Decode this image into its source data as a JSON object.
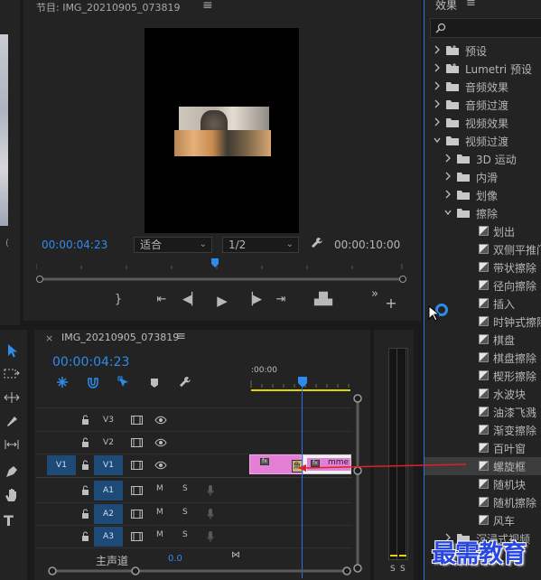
{
  "program": {
    "title": "节目: IMG_20210905_073819",
    "menu": "≡",
    "current_timecode": "00:00:04:23",
    "fit_select": "适合",
    "resolution_select": "1/2",
    "duration_timecode": "00:00:10:00"
  },
  "timeline": {
    "close": "×",
    "title": "IMG_20210905_073819",
    "menu": "≡",
    "timecode": "00:00:04:23",
    "ruler_label": ":00:00",
    "video_tracks": [
      {
        "source": "",
        "name": "V3"
      },
      {
        "source": "",
        "name": "V2"
      },
      {
        "source": "V1",
        "name": "V1"
      }
    ],
    "audio_tracks": [
      {
        "name": "A1",
        "m": "M",
        "s": "S"
      },
      {
        "name": "A2",
        "m": "M",
        "s": "S"
      },
      {
        "name": "A3",
        "m": "M",
        "s": "S"
      }
    ],
    "master_label": "主声道",
    "master_value": "0.0",
    "clip_label": "mme",
    "fx_badge": "fx",
    "transition_badge": "魚"
  },
  "meter": {
    "s1": "S",
    "s2": "S"
  },
  "effects": {
    "title": "效果",
    "menu": "≡",
    "search_placeholder": "",
    "tree": [
      {
        "label": "预设",
        "type": "folder",
        "level": 0,
        "expanded": false,
        "special": true
      },
      {
        "label": "Lumetri 预设",
        "type": "folder",
        "level": 0,
        "expanded": false,
        "special": true
      },
      {
        "label": "音频效果",
        "type": "folder",
        "level": 0,
        "expanded": false
      },
      {
        "label": "音频过渡",
        "type": "folder",
        "level": 0,
        "expanded": false
      },
      {
        "label": "视频效果",
        "type": "folder",
        "level": 0,
        "expanded": false
      },
      {
        "label": "视频过渡",
        "type": "folder",
        "level": 0,
        "expanded": true
      },
      {
        "label": "3D 运动",
        "type": "folder",
        "level": 1,
        "expanded": false
      },
      {
        "label": "内滑",
        "type": "folder",
        "level": 1,
        "expanded": false
      },
      {
        "label": "划像",
        "type": "folder",
        "level": 1,
        "expanded": false
      },
      {
        "label": "擦除",
        "type": "folder",
        "level": 1,
        "expanded": true
      },
      {
        "label": "划出",
        "type": "item",
        "level": 2
      },
      {
        "label": "双侧平推门",
        "type": "item",
        "level": 2
      },
      {
        "label": "带状擦除",
        "type": "item",
        "level": 2
      },
      {
        "label": "径向擦除",
        "type": "item",
        "level": 2
      },
      {
        "label": "插入",
        "type": "item",
        "level": 2
      },
      {
        "label": "时钟式擦除",
        "type": "item",
        "level": 2
      },
      {
        "label": "棋盘",
        "type": "item",
        "level": 2
      },
      {
        "label": "棋盘擦除",
        "type": "item",
        "level": 2
      },
      {
        "label": "楔形擦除",
        "type": "item",
        "level": 2
      },
      {
        "label": "水波块",
        "type": "item",
        "level": 2
      },
      {
        "label": "油漆飞溅",
        "type": "item",
        "level": 2
      },
      {
        "label": "渐变擦除",
        "type": "item",
        "level": 2
      },
      {
        "label": "百叶窗",
        "type": "item",
        "level": 2
      },
      {
        "label": "螺旋框",
        "type": "item",
        "level": 2,
        "selected": true
      },
      {
        "label": "随机块",
        "type": "item",
        "level": 2
      },
      {
        "label": "随机擦除",
        "type": "item",
        "level": 2
      },
      {
        "label": "风车",
        "type": "item",
        "level": 2
      },
      {
        "label": "沉浸式视频",
        "type": "folder",
        "level": 1,
        "expanded": false
      }
    ]
  },
  "watermark": "最需教育",
  "colors": {
    "accent": "#2d8ceb",
    "clip": "#e37fd7",
    "selection": "#3c3c3c",
    "yellow": "#e6d200",
    "arrow": "#e0202a"
  }
}
